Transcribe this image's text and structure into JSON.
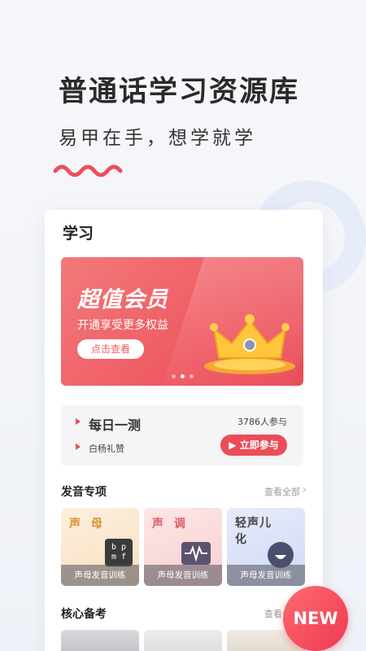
{
  "hero": {
    "title": "普通话学习资源库",
    "subtitle": "易甲在手，想学就学"
  },
  "card": {
    "title": "学习",
    "banner": {
      "title": "超值会员",
      "subtitle": "开通享受更多权益",
      "button_label": "点击查看",
      "active_slide": 1,
      "slide_count": 3
    },
    "daily": {
      "title": "每日一测",
      "participants": "3786人参与",
      "topic": "白杨礼赞",
      "join_label": "▶ 立即参与"
    },
    "pronunciation": {
      "heading": "发音专项",
      "see_all": "查看全部",
      "tiles": [
        {
          "title": "声 母",
          "icon": "bpmf-icon",
          "icon_text_1": "b p",
          "icon_text_2": "m f",
          "label": "声母发音训练"
        },
        {
          "title": "声 调",
          "icon": "waveform-icon",
          "label": "声母发音训练"
        },
        {
          "title": "轻声儿化",
          "icon": "smile-face-icon",
          "label": "声母发音训练"
        }
      ]
    },
    "core": {
      "heading": "核心备考",
      "see_all": "查看全部"
    }
  },
  "badge": {
    "label": "NEW"
  },
  "colors": {
    "accent": "#ea4d58",
    "banner": "#ef5a63"
  }
}
